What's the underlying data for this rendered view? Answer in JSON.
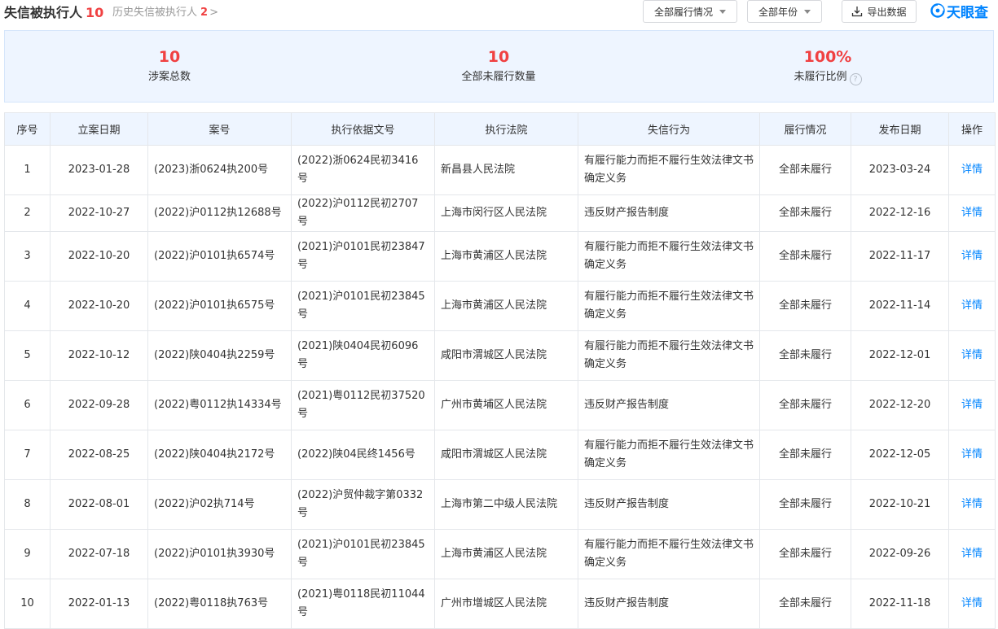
{
  "header": {
    "title": "失信被执行人",
    "title_count": "10",
    "history_label": "历史失信被执行人",
    "history_count": "2",
    "history_chevron": ">",
    "filter_fulfill_label": "全部履行情况",
    "filter_year_label": "全部年份",
    "export_label": "导出数据",
    "logo_text": "天眼查"
  },
  "summary": {
    "total": {
      "value": "10",
      "label": "涉案总数"
    },
    "unfulfilled": {
      "value": "10",
      "label": "全部未履行数量"
    },
    "ratio": {
      "value": "100%",
      "label": "未履行比例"
    },
    "help_glyph": "?"
  },
  "table": {
    "columns": [
      "序号",
      "立案日期",
      "案号",
      "执行依据文号",
      "执行法院",
      "失信行为",
      "履行情况",
      "发布日期",
      "操作"
    ],
    "detail_label": "详情",
    "rows": [
      [
        "1",
        "2023-01-28",
        "(2023)浙0624执200号",
        "(2022)浙0624民初3416号",
        "新昌县人民法院",
        "有履行能力而拒不履行生效法律文书确定义务",
        "全部未履行",
        "2023-03-24"
      ],
      [
        "2",
        "2022-10-27",
        "(2022)沪0112执12688号",
        "(2022)沪0112民初2707号",
        "上海市闵行区人民法院",
        "违反财产报告制度",
        "全部未履行",
        "2022-12-16"
      ],
      [
        "3",
        "2022-10-20",
        "(2022)沪0101执6574号",
        "(2021)沪0101民初23847号",
        "上海市黄浦区人民法院",
        "有履行能力而拒不履行生效法律文书确定义务",
        "全部未履行",
        "2022-11-17"
      ],
      [
        "4",
        "2022-10-20",
        "(2022)沪0101执6575号",
        "(2021)沪0101民初23845号",
        "上海市黄浦区人民法院",
        "有履行能力而拒不履行生效法律文书确定义务",
        "全部未履行",
        "2022-11-14"
      ],
      [
        "5",
        "2022-10-12",
        "(2022)陕0404执2259号",
        "(2021)陕0404民初6096号",
        "咸阳市渭城区人民法院",
        "有履行能力而拒不履行生效法律文书确定义务",
        "全部未履行",
        "2022-12-01"
      ],
      [
        "6",
        "2022-09-28",
        "(2022)粤0112执14334号",
        "(2021)粤0112民初37520号",
        "广州市黄埔区人民法院",
        "违反财产报告制度",
        "全部未履行",
        "2022-12-20"
      ],
      [
        "7",
        "2022-08-25",
        "(2022)陕0404执2172号",
        "(2022)陕04民终1456号",
        "咸阳市渭城区人民法院",
        "有履行能力而拒不履行生效法律文书确定义务",
        "全部未履行",
        "2022-12-05"
      ],
      [
        "8",
        "2022-08-01",
        "(2022)沪02执714号",
        "(2022)沪贸仲裁字第0332号",
        "上海市第二中级人民法院",
        "违反财产报告制度",
        "全部未履行",
        "2022-10-21"
      ],
      [
        "9",
        "2022-07-18",
        "(2022)沪0101执3930号",
        "(2021)沪0101民初23845号",
        "上海市黄浦区人民法院",
        "有履行能力而拒不履行生效法律文书确定义务",
        "全部未履行",
        "2022-09-26"
      ],
      [
        "10",
        "2022-01-13",
        "(2022)粤0118执763号",
        "(2021)粤0118民初11044号",
        "广州市增城区人民法院",
        "违反财产报告制度",
        "全部未履行",
        "2022-11-18"
      ]
    ]
  },
  "colors": {
    "accent": "#0084ff",
    "alert": "#f04142",
    "summary_bg": "#eef5ff"
  }
}
